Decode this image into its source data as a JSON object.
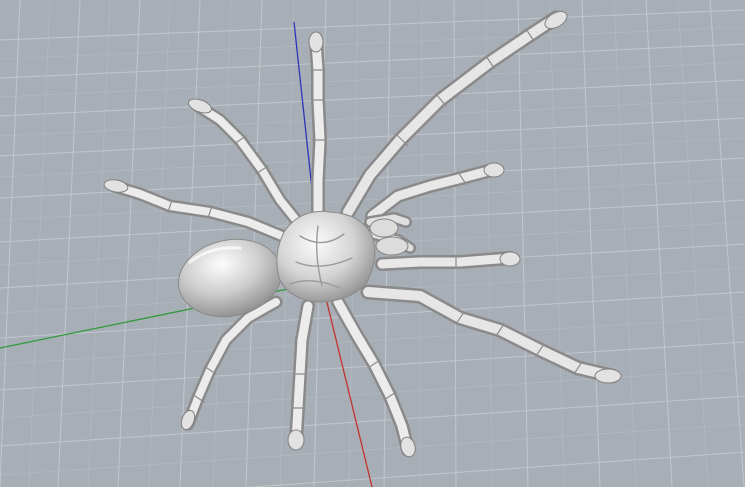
{
  "viewport": {
    "label": "",
    "colors": {
      "background": "#a8aeb5",
      "grid_line": "#bfc5cb",
      "grid_major": "#9aa0a7",
      "axis_x": "#c0332f",
      "axis_y": "#2f9a3a",
      "axis_z": "#2d36b8",
      "model_light": "#f4f4f4",
      "model_mid": "#cfcfcf",
      "model_dark": "#8e8e8e"
    },
    "model": "spider-mesh",
    "display_mode": "rendered"
  }
}
